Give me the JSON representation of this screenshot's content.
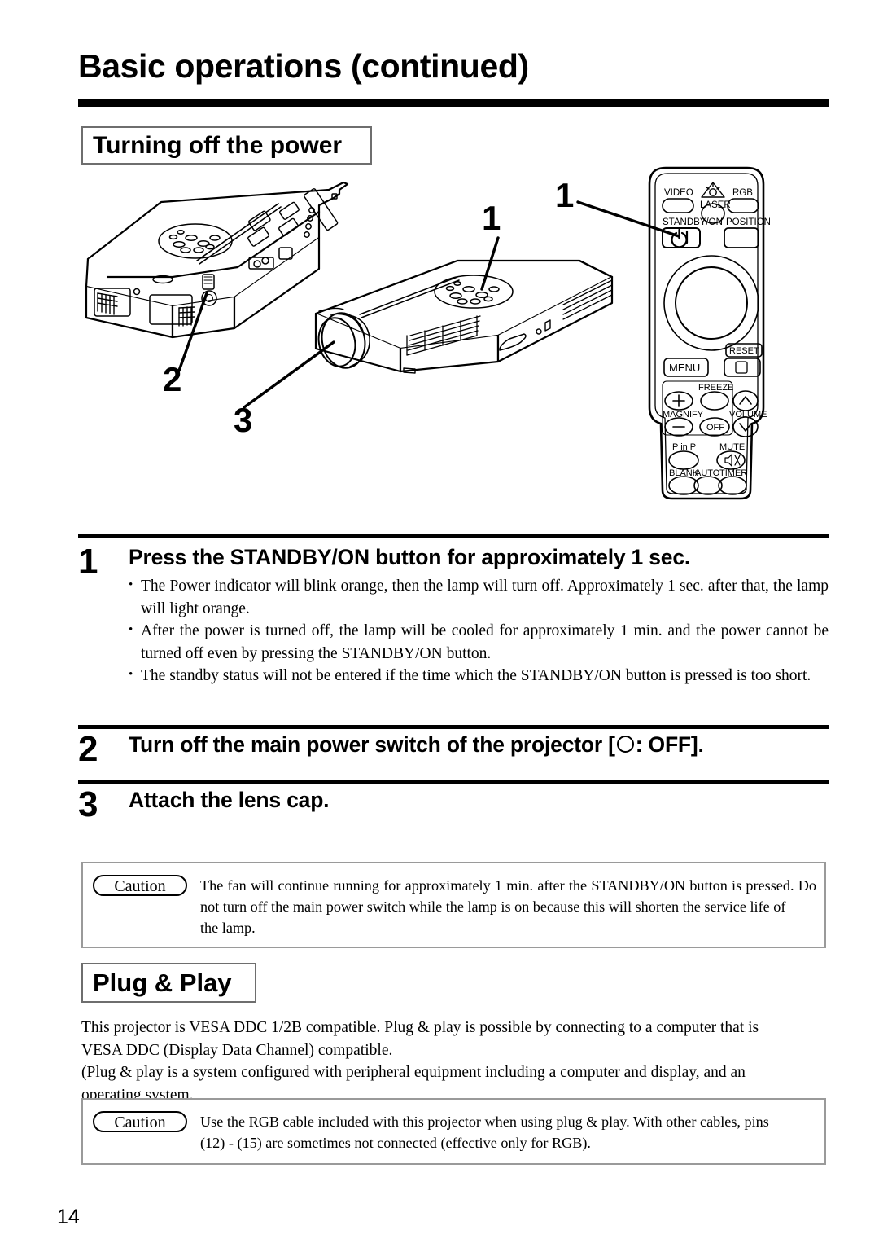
{
  "document": {
    "title": "Basic operations (continued)",
    "page_number": "14"
  },
  "sections": {
    "turning_off": {
      "heading": "Turning off the power"
    },
    "plug_play": {
      "heading": "Plug & Play"
    }
  },
  "figure": {
    "callouts": [
      {
        "id": "1",
        "label": "1",
        "target": "control-panel-standby-on"
      },
      {
        "id": "1r",
        "label": "1",
        "target": "remote-standby-on-button"
      },
      {
        "id": "2",
        "label": "2",
        "target": "main-power-switch"
      },
      {
        "id": "3",
        "label": "3",
        "target": "lens-cap"
      }
    ],
    "remote_buttons": {
      "video": "VIDEO",
      "laser": "LASER",
      "rgb": "RGB",
      "standby_on": "STANDBY/ON",
      "position": "POSITION",
      "reset": "RESET",
      "menu": "MENU",
      "freeze": "FREEZE",
      "magnify": "MAGNIFY",
      "magnify_off": "OFF",
      "volume": "VOLUME",
      "pinp": "P in P",
      "mute": "MUTE",
      "blank": "BLANK",
      "auto": "AUTO",
      "timer": "TIMER"
    }
  },
  "steps": [
    {
      "number": "1",
      "heading": "Press the STANDBY/ON button for approximately 1 sec.",
      "bullets": [
        "The Power indicator will blink orange, then the lamp will turn off. Approximately 1 sec. after that, the lamp will light orange.",
        "After the power is turned off, the lamp will be cooled for approximately 1 min. and the power cannot be turned off even by pressing the STANDBY/ON button.",
        "The standby status will not be entered if the time which the STANDBY/ON button is pressed is too short."
      ]
    },
    {
      "number": "2",
      "heading_before": "Turn off the main power switch of the projector [",
      "heading_after": ": OFF].",
      "bullets": []
    },
    {
      "number": "3",
      "heading": "Attach the lens cap.",
      "bullets": []
    }
  ],
  "cautions": [
    {
      "label": "Caution",
      "body": "The fan will continue running for approximately 1 min. after the STANDBY/ON button is pressed. Do not turn off the main power switch while the lamp is on because this will shorten the service life of",
      "body_last": "the lamp."
    },
    {
      "label": "Caution",
      "body": "Use the RGB cable included with this projector when using plug & play. With other cables, pins",
      "body_last": "(12) - (15) are sometimes not connected (effective only for RGB)."
    }
  ],
  "plug_play_body": {
    "paragraph1": "This projector is VESA DDC 1/2B compatible. Plug & play is possible by connecting to a computer that is",
    "paragraph1_last": "VESA DDC (Display Data Channel) compatible.",
    "paragraph2": "(Plug & play is a system configured with peripheral equipment including a computer and display, and an",
    "paragraph2_last": "operating system."
  }
}
